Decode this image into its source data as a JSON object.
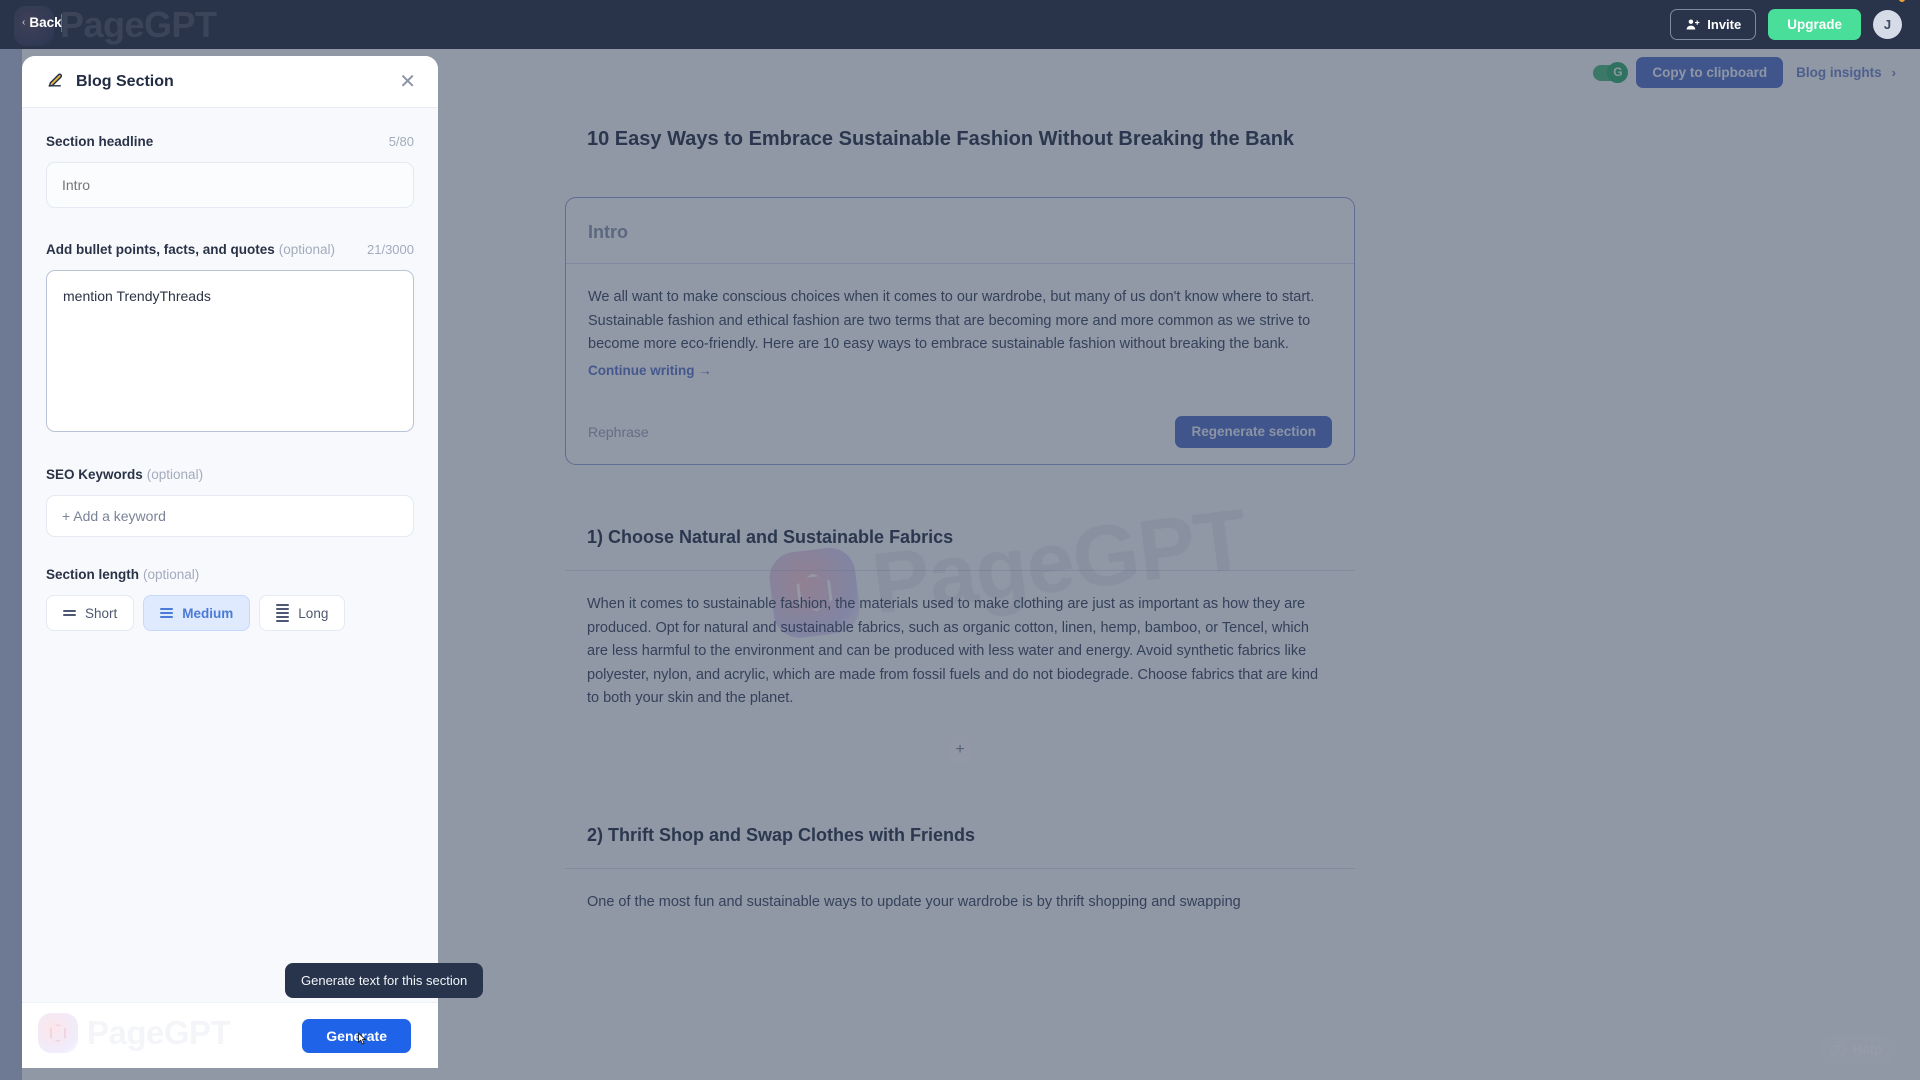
{
  "topbar": {
    "back_label": "Back",
    "back_chevron": "chevron-left-icon",
    "brand_watermark": "PageGPT",
    "invite_label": "Invite",
    "upgrade_label": "Upgrade",
    "avatar_initial": "J",
    "green_accent": "#4ade9b"
  },
  "doc_toolbar": {
    "copy_label": "Copy to clipboard",
    "insights_label": "Blog insights",
    "insights_chevron": "›",
    "toggle_state": "on",
    "toggle_glyph": "G"
  },
  "document": {
    "title": "10 Easy Ways to Embrace Sustainable Fashion Without Breaking the Bank",
    "intro": {
      "heading_placeholder": "Intro",
      "body": "We all want to make conscious choices when it comes to our wardrobe, but many of us don't know where to start. Sustainable fashion and ethical fashion are two terms that are becoming more and more common as we strive to become more eco-friendly. Here are 10 easy ways to embrace sustainable fashion without breaking the bank.",
      "continue_label": "Continue writing →",
      "rephrase_label": "Rephrase",
      "regenerate_label": "Regenerate section"
    },
    "sections": [
      {
        "heading": "1) Choose Natural and Sustainable Fabrics",
        "body": "When it comes to sustainable fashion, the materials used to make clothing are just as important as how they are produced. Opt for natural and sustainable fabrics, such as organic cotton, linen, hemp, bamboo, or Tencel, which are less harmful to the environment and can be produced with less water and energy. Avoid synthetic fabrics like polyester, nylon, and acrylic, which are made from fossil fuels and do not biodegrade. Choose fabrics that are kind to both your skin and the planet."
      },
      {
        "heading": "2) Thrift Shop and Swap Clothes with Friends",
        "body": "One of the most fun and sustainable ways to update your wardrobe is by thrift shopping and swapping"
      }
    ],
    "add_section_glyph": "+",
    "watermark": "PageGPT"
  },
  "help": {
    "label": "Help",
    "glyph": "?"
  },
  "panel": {
    "icon": "pencil-edit-icon",
    "icon_glyph": "✎",
    "title": "Blog Section",
    "close_glyph": "✕",
    "headline": {
      "label": "Section headline",
      "counter": "5/80",
      "value": "",
      "placeholder": "Intro"
    },
    "bullets": {
      "label": "Add bullet points, facts, and quotes",
      "optional": "(optional)",
      "counter": "21/3000",
      "value": "mention TrendyThreads",
      "placeholder": ""
    },
    "seo": {
      "label": "SEO Keywords",
      "optional": "(optional)",
      "add_label": "+ Add a keyword"
    },
    "length": {
      "label": "Section length",
      "optional": "(optional)",
      "options": [
        {
          "label": "Short",
          "lines": 2,
          "selected": false
        },
        {
          "label": "Medium",
          "lines": 3,
          "selected": true
        },
        {
          "label": "Long",
          "lines": 5,
          "selected": false
        }
      ]
    },
    "footer": {
      "generate_label": "Generate",
      "watermark": "PageGPT",
      "accent": "#1f63e8"
    }
  },
  "tooltip": {
    "text": "Generate text for this section"
  }
}
